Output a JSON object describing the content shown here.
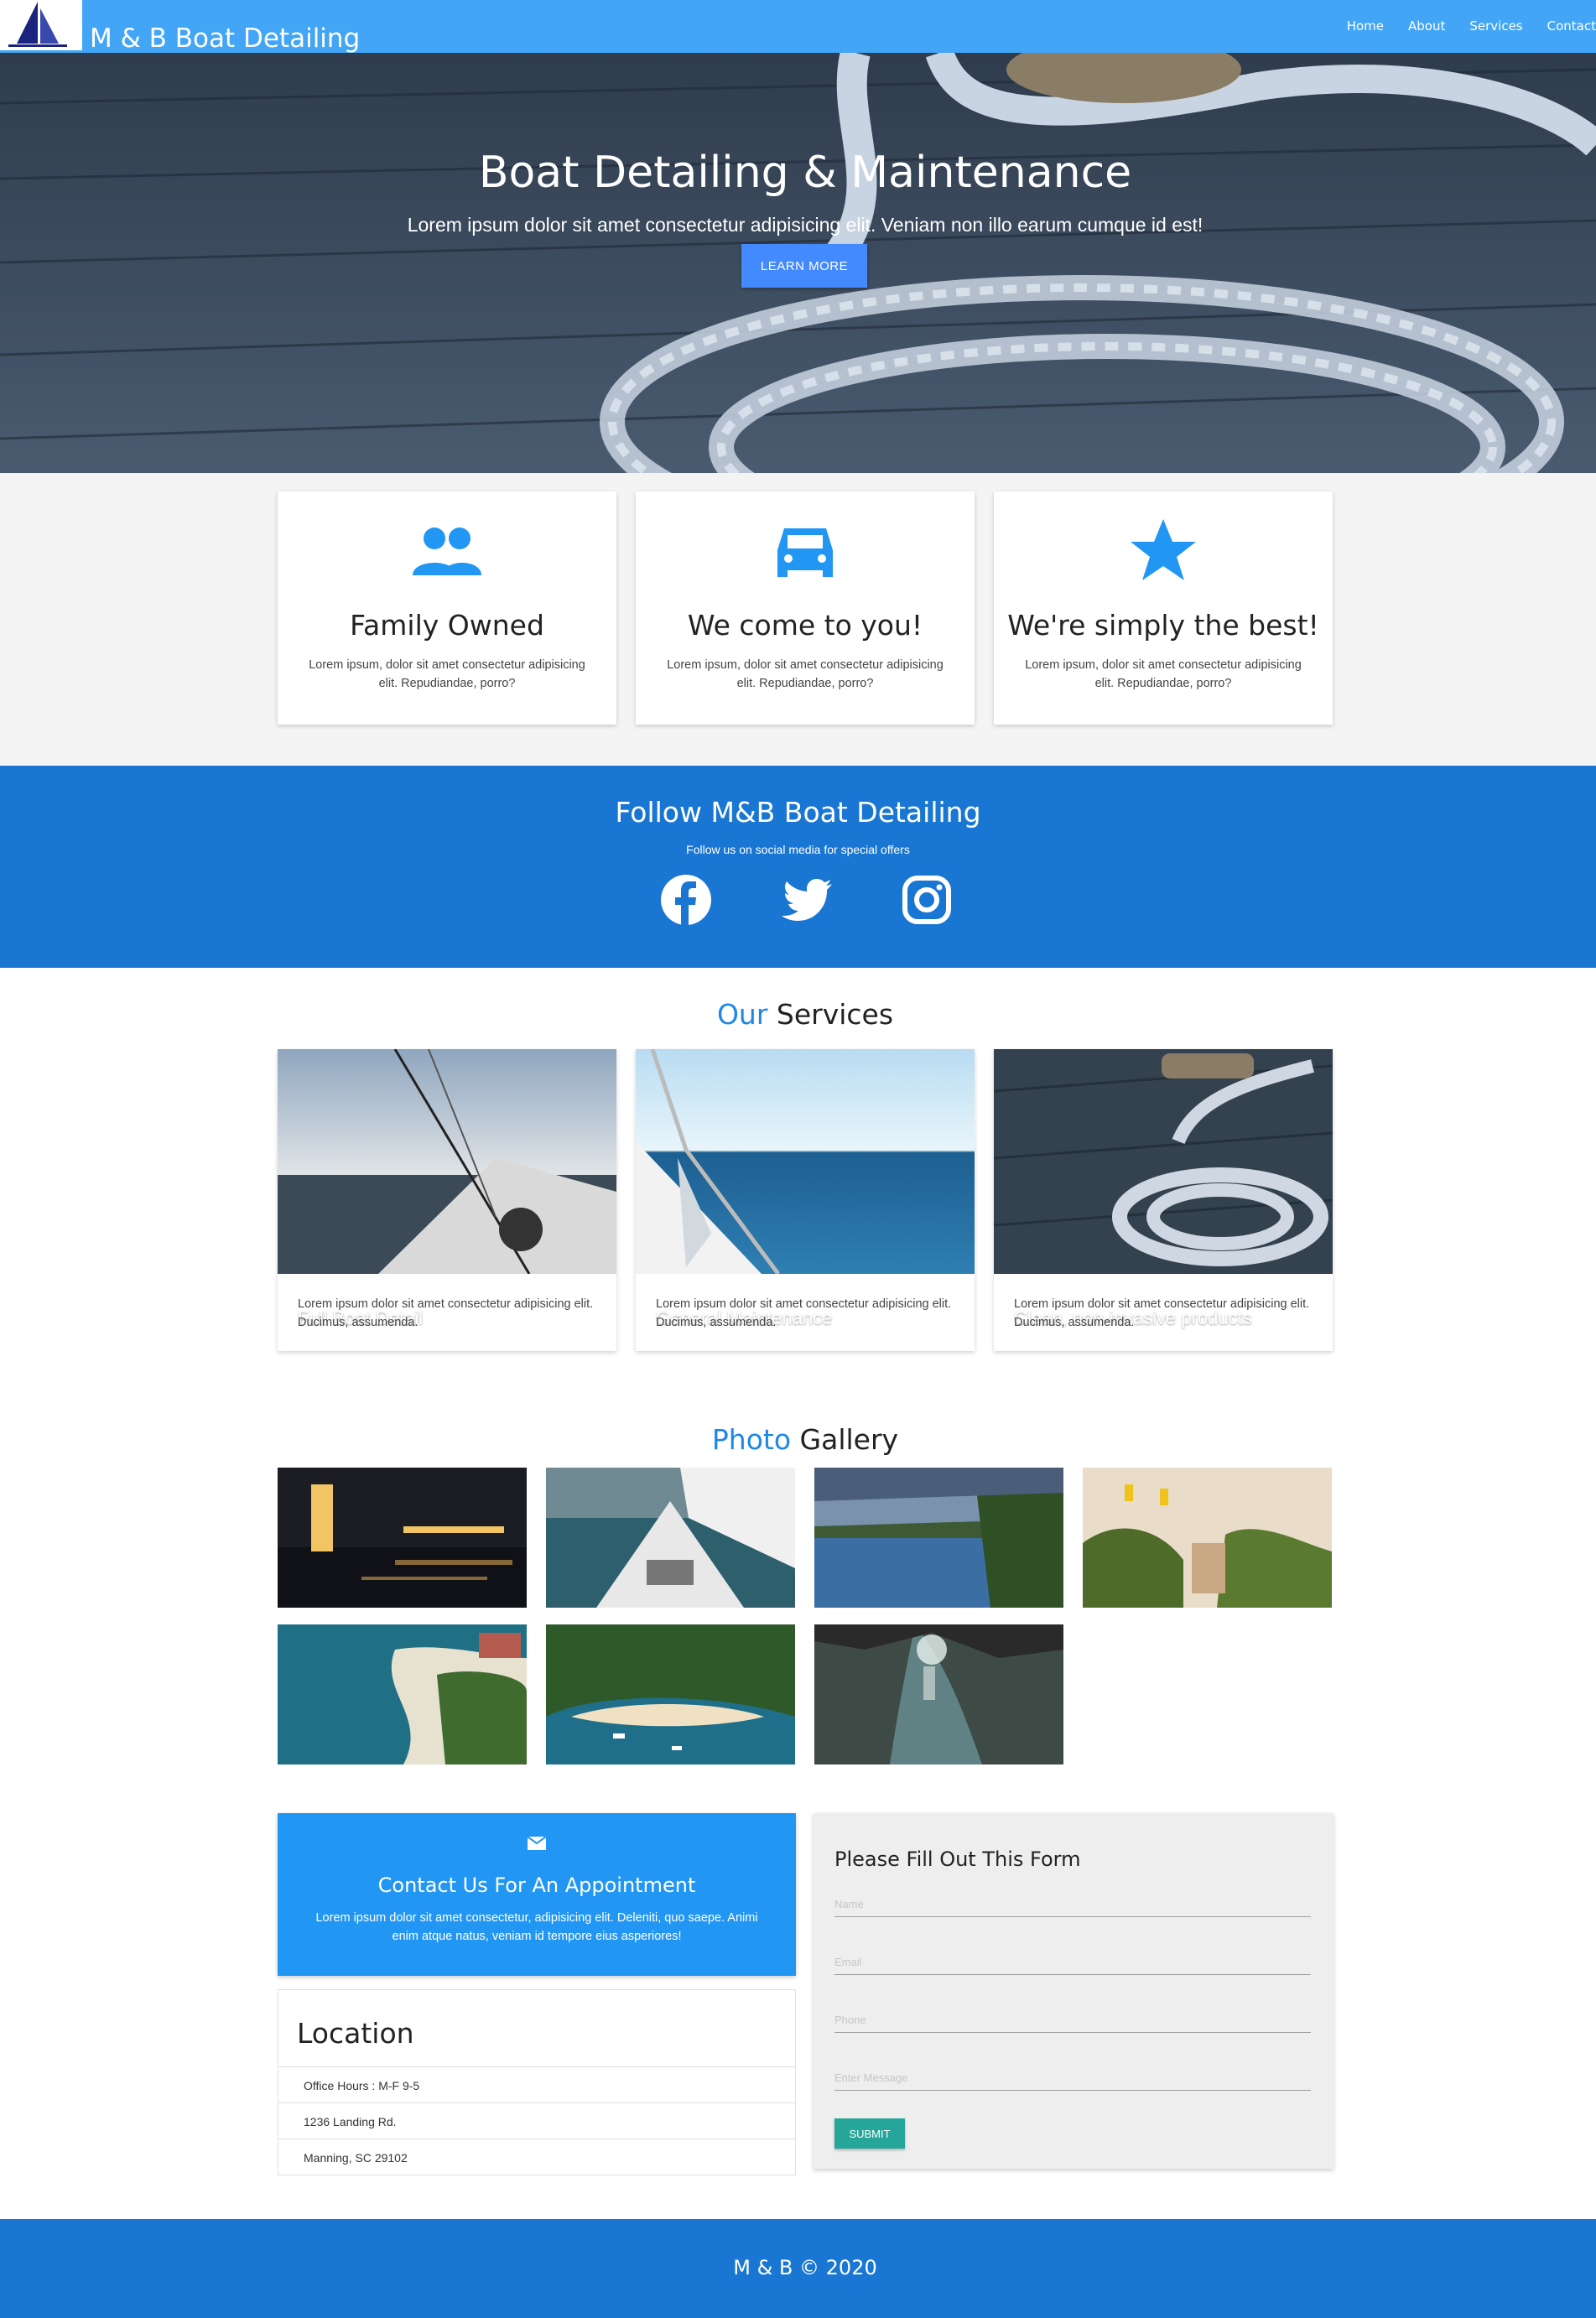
{
  "nav": {
    "brand": "M & B Boat Detailing",
    "links": [
      "Home",
      "About",
      "Services",
      "Contact"
    ]
  },
  "hero": {
    "title": "Boat Detailing & Maintenance",
    "subtitle": "Lorem ipsum dolor sit amet consectetur adipisicing elit. Veniam non illo earum cumque id est!",
    "button": "LEARN MORE"
  },
  "features": [
    {
      "icon": "people-icon",
      "title": "Family Owned",
      "text": "Lorem ipsum, dolor sit amet consectetur adipisicing elit. Repudiandae, porro?"
    },
    {
      "icon": "car-icon",
      "title": "We come to you!",
      "text": "Lorem ipsum, dolor sit amet consectetur adipisicing elit. Repudiandae, porro?"
    },
    {
      "icon": "star-icon",
      "title": "We're simply the best!",
      "text": "Lorem ipsum, dolor sit amet consectetur adipisicing elit. Repudiandae, porro?"
    }
  ],
  "follow": {
    "title": "Follow M&B Boat Detailing",
    "subtitle": "Follow us on social media for special offers",
    "icons": [
      "facebook-icon",
      "twitter-icon",
      "instagram-icon"
    ]
  },
  "services": {
    "title_accent": "Our",
    "title_rest": " Services",
    "cards": [
      {
        "caption": "Full Boat Detail",
        "text": "Lorem ipsum dolor sit amet consectetur adipisicing elit. Ducimus, assumenda."
      },
      {
        "caption": "General Maintenance",
        "text": "Lorem ipsum dolor sit amet consectetur adipisicing elit. Ducimus, assumenda."
      },
      {
        "caption": "Clean, non-invasive products",
        "text": "Lorem ipsum dolor sit amet consectetur adipisicing elit. Ducimus, assumenda."
      }
    ]
  },
  "gallery": {
    "title_accent": "Photo",
    "title_rest": " Gallery"
  },
  "contact": {
    "title": "Contact Us For An Appointment",
    "text": "Lorem ipsum dolor sit amet consectetur, adipisicing elit. Deleniti, quo saepe. Animi enim atque natus, veniam id tempore eius asperiores!"
  },
  "location": {
    "title": "Location",
    "items": [
      "Office Hours : M-F 9-5",
      "1236 Landing Rd.",
      "Manning, SC 29102"
    ]
  },
  "form": {
    "title": "Please Fill Out This Form",
    "name_placeholder": "Name",
    "email_placeholder": "Email",
    "phone_placeholder": "Phone",
    "message_placeholder": "Enter Message",
    "submit": "SUBMIT"
  },
  "footer": {
    "text": "M & B © 2020"
  },
  "colors": {
    "nav": "#42a5f5",
    "primary": "#1976d2",
    "accent": "#1e88e5",
    "button": "#448aff",
    "submit": "#26a69a"
  }
}
